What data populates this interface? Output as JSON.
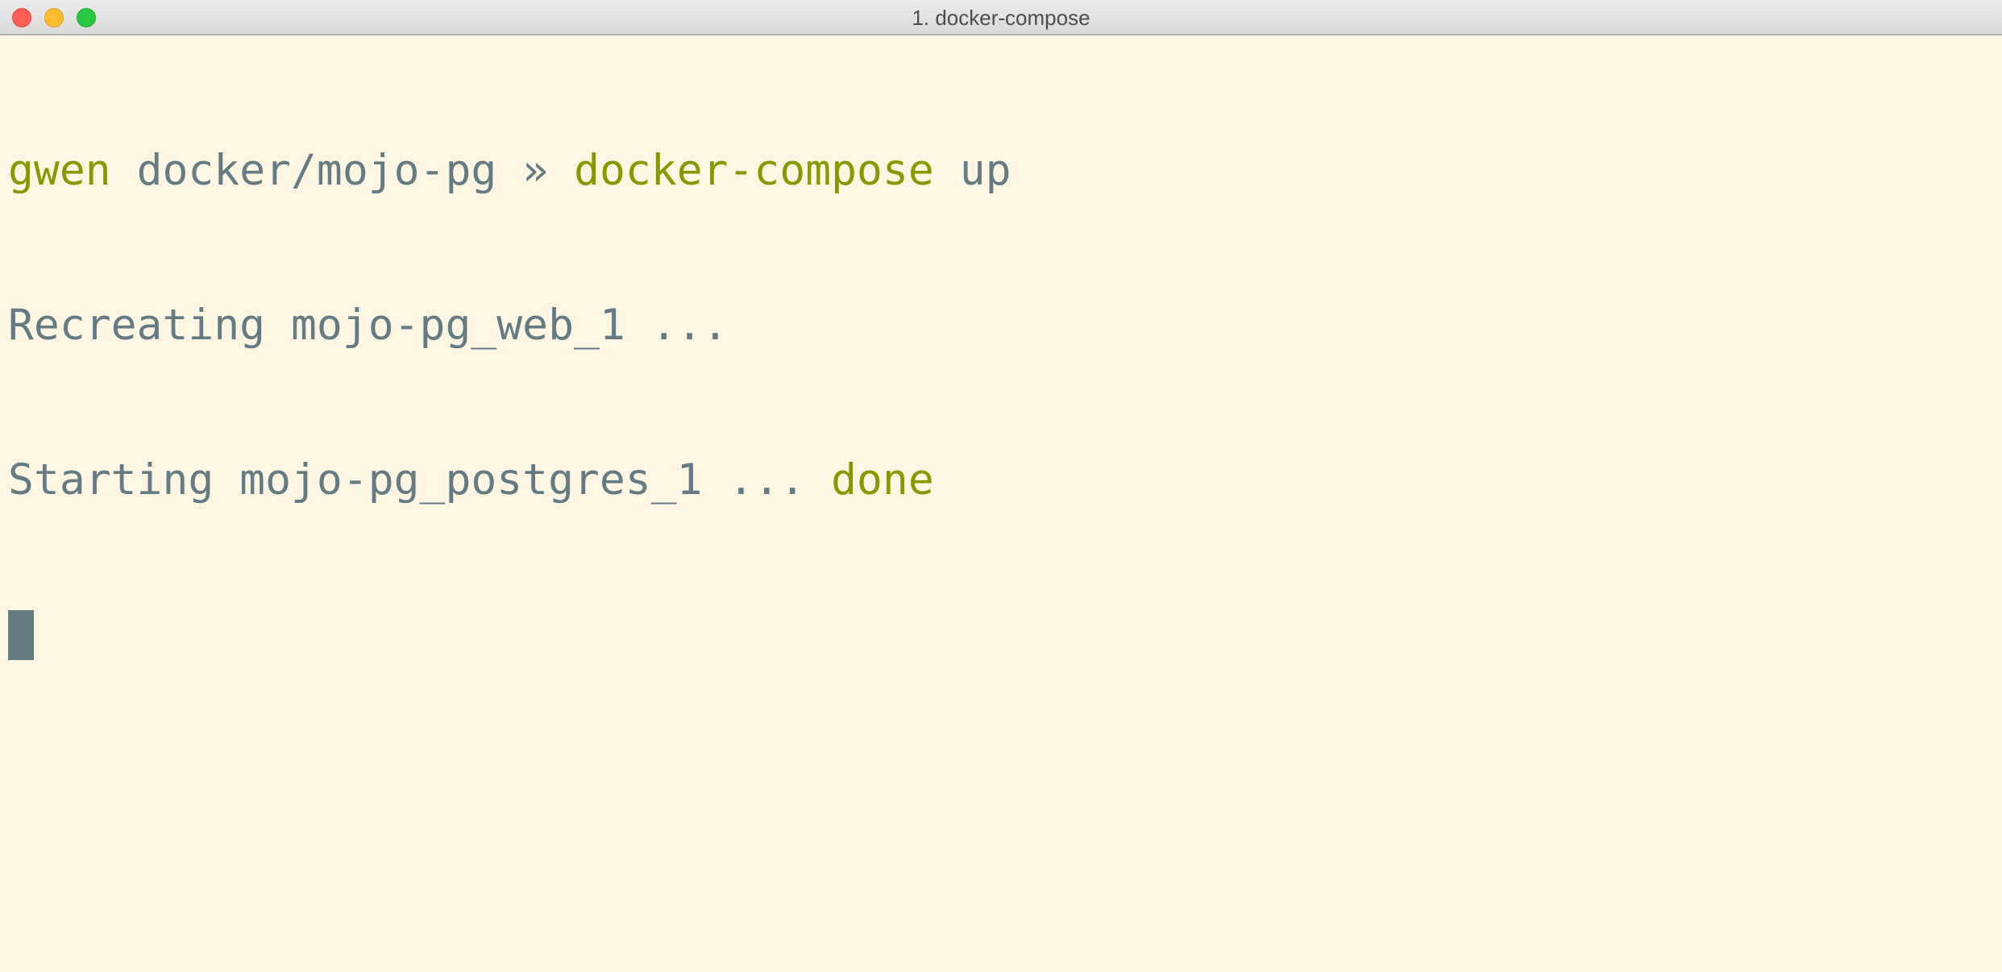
{
  "window": {
    "title": "1. docker-compose"
  },
  "terminal": {
    "prompt": {
      "user": "gwen",
      "path": "docker/mojo-pg",
      "separator": "»",
      "command": "docker-compose",
      "argument": "up"
    },
    "output": [
      {
        "text": "Recreating mojo-pg_web_1 ...",
        "status": ""
      },
      {
        "text": "Starting mojo-pg_postgres_1 ...",
        "status": "done"
      }
    ]
  },
  "colors": {
    "background": "#fdf6e3",
    "foreground": "#657b83",
    "green": "#859900"
  }
}
